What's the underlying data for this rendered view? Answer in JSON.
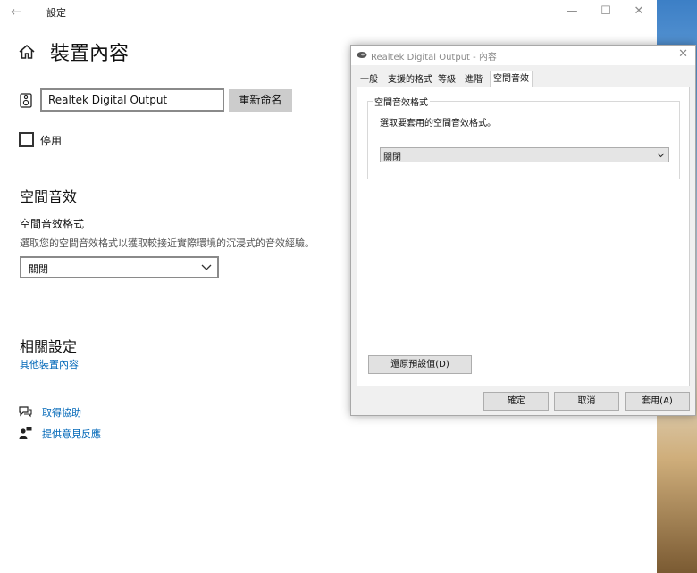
{
  "settings": {
    "title": "設定",
    "page_title": "裝置內容",
    "device_name": "Realtek Digital Output",
    "rename_label": "重新命名",
    "disable_label": "停用",
    "spatial": {
      "heading": "空間音效",
      "field_label": "空間音效格式",
      "description": "選取您的空間音效格式以獲取較接近實際環境的沉浸式的音效經驗。",
      "selected": "關閉"
    },
    "related": {
      "heading": "相關設定",
      "link": "其他裝置內容"
    },
    "help": {
      "get_help": "取得協助",
      "feedback": "提供意見反應"
    }
  },
  "dialog": {
    "title": "Realtek Digital Output - 內容",
    "tabs": [
      "一般",
      "支援的格式",
      "等級",
      "進階",
      "空間音效"
    ],
    "active_tab": "空間音效",
    "group_title": "空間音效格式",
    "group_desc": "選取要套用的空間音效格式。",
    "selected": "關閉",
    "restore_label": "還原預設值(D)",
    "ok_label": "確定",
    "cancel_label": "取消",
    "apply_label": "套用(A)"
  },
  "colors": {
    "link": "#0067b8",
    "button_gray": "#cccccc"
  }
}
